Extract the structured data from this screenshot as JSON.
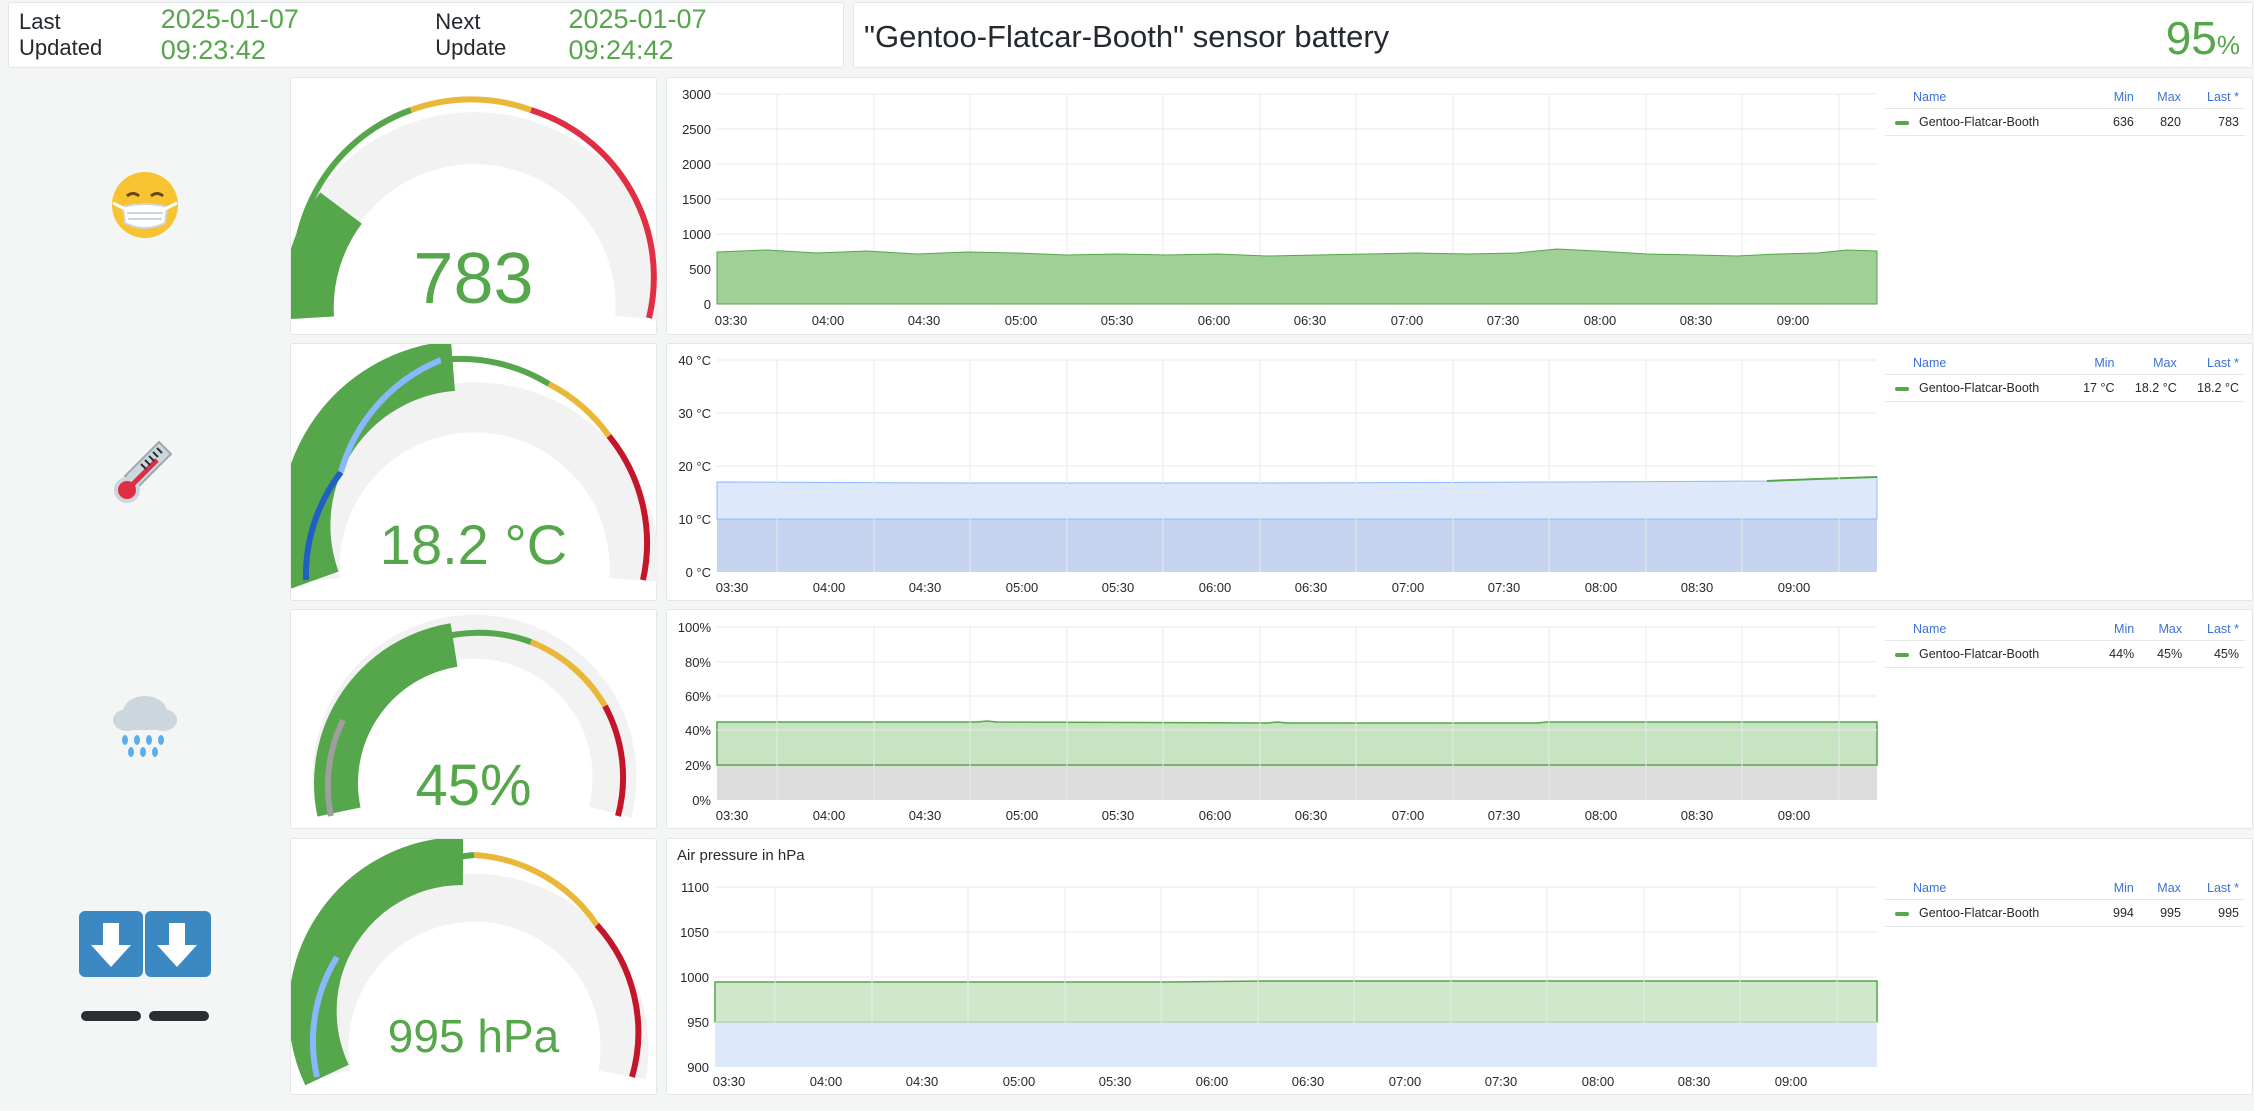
{
  "header": {
    "last_updated_label": "Last Updated",
    "last_updated_value": "2025-01-07 09:23:42",
    "next_update_label": "Next Update",
    "next_update_value": "2025-01-07 09:24:42",
    "battery_title": "\"Gentoo-Flatcar-Booth\" sensor battery",
    "battery_value": "95",
    "battery_unit": "%"
  },
  "colors": {
    "accent": "#56a64b",
    "blue": "#3d71d9",
    "yellow": "#eab839",
    "red": "#c4162a"
  },
  "x_ticks": [
    "03:30",
    "04:00",
    "04:30",
    "05:00",
    "05:30",
    "06:00",
    "06:30",
    "07:00",
    "07:30",
    "08:00",
    "08:30",
    "09:00"
  ],
  "rows": [
    {
      "icon": "face-with-medical-mask-icon",
      "gauge": {
        "display": "783",
        "value": 783,
        "min": 0,
        "max": 3000
      },
      "chart": {
        "title": "",
        "y_ticks": [
          "3000",
          "2500",
          "2000",
          "1500",
          "1000",
          "500",
          "0"
        ],
        "ylim": [
          0,
          3000
        ],
        "series_value_range": [
          636,
          820
        ]
      },
      "legend": {
        "headers": [
          "Name",
          "Min",
          "Max",
          "Last *"
        ],
        "series": "Gentoo-Flatcar-Booth",
        "min": "636",
        "max": "820",
        "last": "783"
      }
    },
    {
      "icon": "thermometer-icon",
      "gauge": {
        "display": "18.2 °C",
        "value": 18.2,
        "min": 0,
        "max": 40
      },
      "chart": {
        "title": "",
        "y_ticks": [
          "40 °C",
          "30 °C",
          "20 °C",
          "10 °C",
          "0 °C"
        ],
        "ylim": [
          0,
          40
        ],
        "series_value_range": [
          17,
          18.2
        ]
      },
      "legend": {
        "headers": [
          "Name",
          "Min",
          "Max",
          "Last *"
        ],
        "series": "Gentoo-Flatcar-Booth",
        "min": "17 °C",
        "max": "18.2 °C",
        "last": "18.2 °C"
      }
    },
    {
      "icon": "cloud-with-rain-icon",
      "gauge": {
        "display": "45%",
        "value": 45,
        "min": 0,
        "max": 100
      },
      "chart": {
        "title": "",
        "y_ticks": [
          "100%",
          "80%",
          "60%",
          "40%",
          "20%",
          "0%"
        ],
        "ylim": [
          0,
          100
        ],
        "series_value_range": [
          44,
          45
        ]
      },
      "legend": {
        "headers": [
          "Name",
          "Min",
          "Max",
          "Last *"
        ],
        "series": "Gentoo-Flatcar-Booth",
        "min": "44%",
        "max": "45%",
        "last": "45%"
      }
    },
    {
      "icon": "pressure-arrows-icon",
      "gauge": {
        "display": "995 hPa",
        "value": 995,
        "min": 900,
        "max": 1100
      },
      "chart": {
        "title": "Air pressure in hPa",
        "y_ticks": [
          "1100",
          "1050",
          "1000",
          "950",
          "900"
        ],
        "ylim": [
          900,
          1100
        ],
        "series_value_range": [
          994,
          995
        ]
      },
      "legend": {
        "headers": [
          "Name",
          "Min",
          "Max",
          "Last *"
        ],
        "series": "Gentoo-Flatcar-Booth",
        "min": "994",
        "max": "995",
        "last": "995"
      }
    }
  ]
}
